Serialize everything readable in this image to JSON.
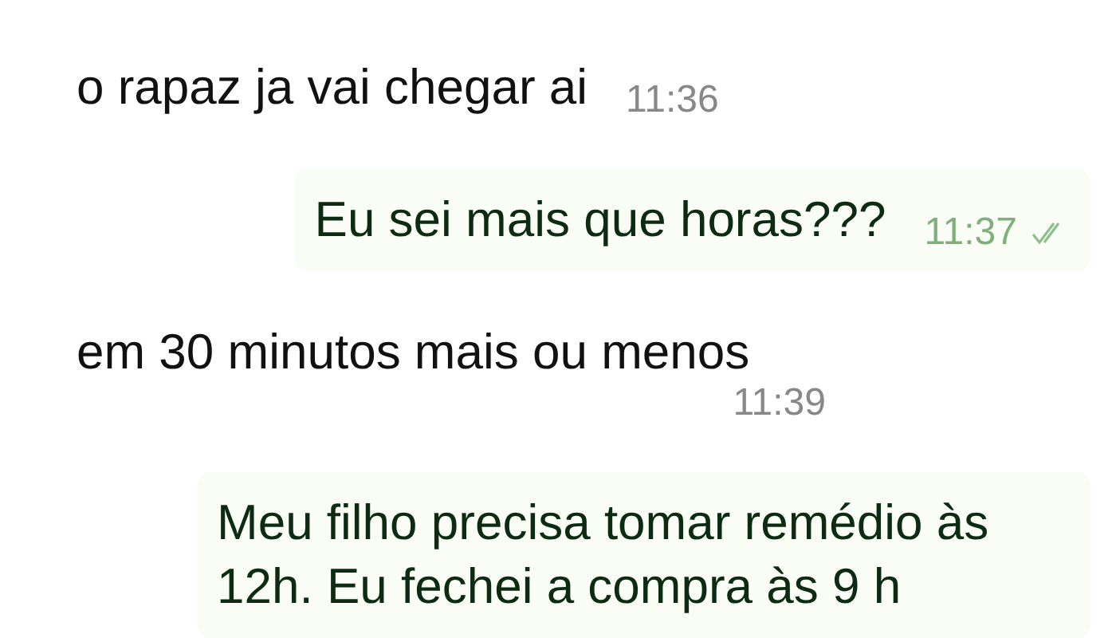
{
  "messages": [
    {
      "kind": "incoming",
      "text": "o rapaz ja vai chegar ai",
      "time": "11:36"
    },
    {
      "kind": "outgoing",
      "text": "Eu sei mais que horas???",
      "time": "11:37",
      "read": false
    },
    {
      "kind": "incoming",
      "text": "em 30 minutos mais ou menos",
      "time": "11:39"
    },
    {
      "kind": "outgoing",
      "text": "Meu filho precisa tomar remédio às 12h. Eu fechei a compra às 9 h"
    }
  ]
}
